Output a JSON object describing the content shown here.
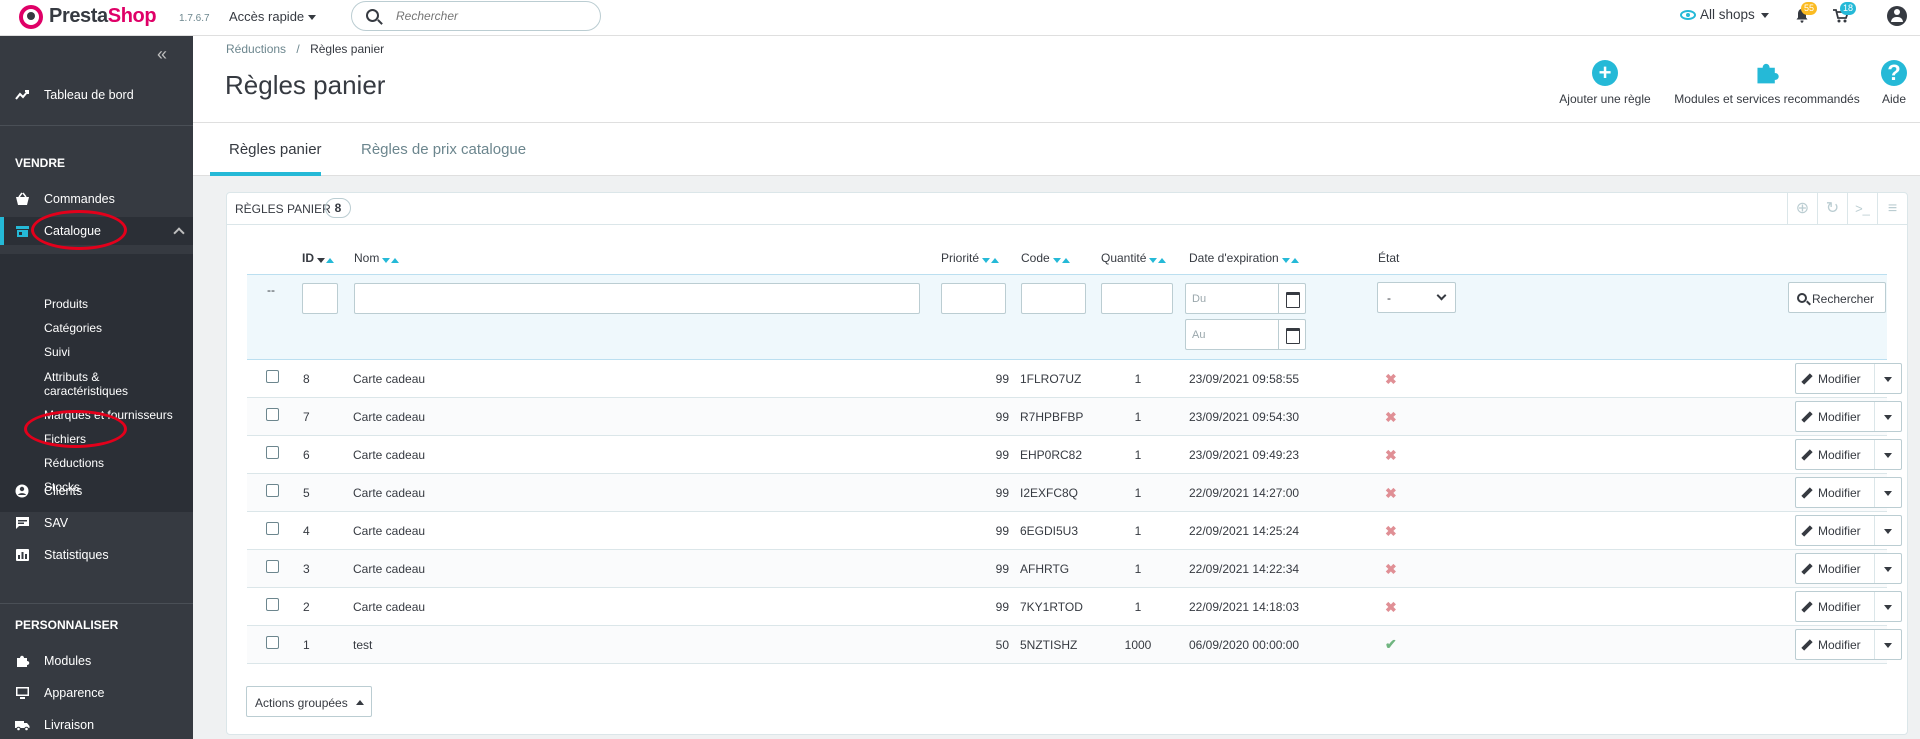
{
  "header": {
    "brand_presta": "Presta",
    "brand_shop": "Shop",
    "version": "1.7.6.7",
    "quick_access": "Accès rapide",
    "search_placeholder": "Rechercher",
    "shop_selector": "All shops",
    "orders_badge": "55",
    "customers_badge": "18"
  },
  "sidebar": {
    "dashboard": "Tableau de bord",
    "section_sell": "VENDRE",
    "orders": "Commandes",
    "catalog": "Catalogue",
    "catalog_sub": [
      "Produits",
      "Catégories",
      "Suivi",
      "Attributs &",
      "caractéristiques",
      "Marques et fournisseurs",
      "Fichiers",
      "Réductions",
      "Stocks"
    ],
    "customers": "Clients",
    "sav": "SAV",
    "stats": "Statistiques",
    "section_customize": "PERSONNALISER",
    "modules": "Modules",
    "appearance": "Apparence",
    "shipping": "Livraison"
  },
  "page": {
    "breadcrumb_parent": "Réductions",
    "breadcrumb_sep": "/",
    "breadcrumb_current": "Règles panier",
    "title": "Règles panier",
    "toolbar": {
      "add_rule": "Ajouter une règle",
      "modules": "Modules et services recommandés",
      "help": "Aide"
    },
    "tabs": [
      "Règles panier",
      "Règles de prix catalogue"
    ]
  },
  "panel": {
    "title": "RÈGLES PANIER",
    "count": "8",
    "columns": {
      "id": "ID",
      "name": "Nom",
      "priority": "Priorité",
      "code": "Code",
      "quantity": "Quantité",
      "expiration": "Date d'expiration",
      "state": "État"
    },
    "filter": {
      "dash": "--",
      "from_placeholder": "Du",
      "to_placeholder": "Au",
      "state_value": "-",
      "search_button": "Rechercher"
    },
    "rows": [
      {
        "id": "8",
        "name": "Carte cadeau",
        "priority": "99",
        "code": "1FLRO7UZ",
        "qty": "1",
        "date": "23/09/2021 09:58:55",
        "active": false
      },
      {
        "id": "7",
        "name": "Carte cadeau",
        "priority": "99",
        "code": "R7HPBFBP",
        "qty": "1",
        "date": "23/09/2021 09:54:30",
        "active": false
      },
      {
        "id": "6",
        "name": "Carte cadeau",
        "priority": "99",
        "code": "EHP0RC82",
        "qty": "1",
        "date": "23/09/2021 09:49:23",
        "active": false
      },
      {
        "id": "5",
        "name": "Carte cadeau",
        "priority": "99",
        "code": "I2EXFC8Q",
        "qty": "1",
        "date": "22/09/2021 14:27:00",
        "active": false
      },
      {
        "id": "4",
        "name": "Carte cadeau",
        "priority": "99",
        "code": "6EGDI5U3",
        "qty": "1",
        "date": "22/09/2021 14:25:24",
        "active": false
      },
      {
        "id": "3",
        "name": "Carte cadeau",
        "priority": "99",
        "code": "AFHRTG",
        "qty": "1",
        "date": "22/09/2021 14:22:34",
        "active": false
      },
      {
        "id": "2",
        "name": "Carte cadeau",
        "priority": "99",
        "code": "7KY1RTOD",
        "qty": "1",
        "date": "22/09/2021 14:18:03",
        "active": false
      },
      {
        "id": "1",
        "name": "test",
        "priority": "50",
        "code": "5NZTISHZ",
        "qty": "1000",
        "date": "06/09/2020 00:00:00",
        "active": true
      }
    ],
    "edit_label": "Modifier",
    "bulk_actions": "Actions groupées"
  },
  "colors": {
    "accent": "#25b9d7",
    "brand": "#df0067",
    "annotation": "#e3001b"
  }
}
